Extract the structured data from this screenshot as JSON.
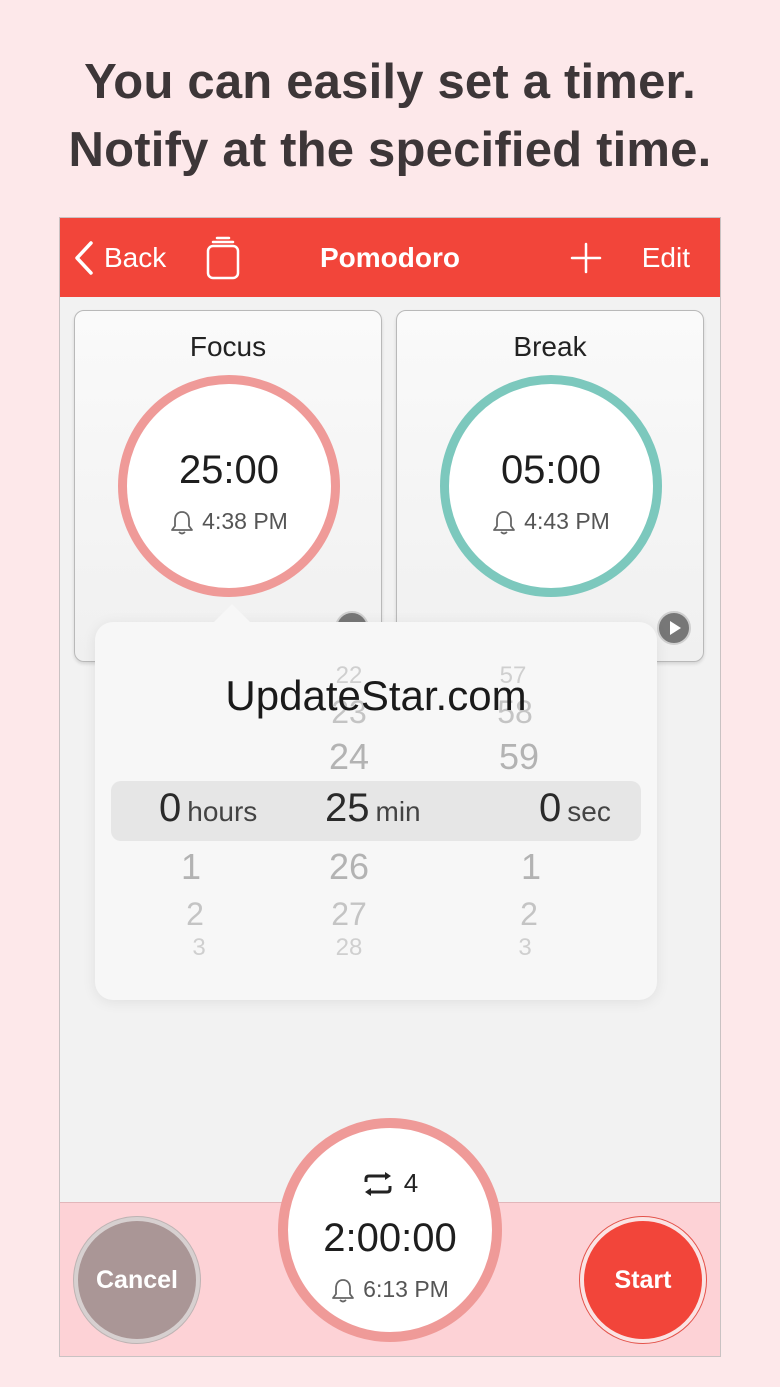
{
  "headline": {
    "line1": "You can easily set a timer.",
    "line2": "Notify at the specified time."
  },
  "navbar": {
    "back_label": "Back",
    "title": "Pomodoro",
    "edit_label": "Edit",
    "color": "#f2453a"
  },
  "cards": [
    {
      "title": "Focus",
      "time": "25:00",
      "alarm": "4:38 PM",
      "ring_color": "#ef9a98"
    },
    {
      "title": "Break",
      "time": "05:00",
      "alarm": "4:43 PM",
      "ring_color": "#7cc8bd"
    }
  ],
  "picker": {
    "hours": {
      "above": [],
      "selected": "0",
      "unit": "hours",
      "below": [
        "1",
        "2",
        "3"
      ]
    },
    "minutes": {
      "above": [
        "22",
        "23",
        "24"
      ],
      "selected": "25",
      "unit": "min",
      "below": [
        "26",
        "27",
        "28"
      ]
    },
    "seconds": {
      "above": [
        "57",
        "58",
        "59"
      ],
      "selected": "0",
      "unit": "sec",
      "below": [
        "1",
        "2",
        "3"
      ]
    }
  },
  "watermark": "UpdateStar.com",
  "bottom": {
    "cancel_label": "Cancel",
    "start_label": "Start",
    "repeat_count": "4",
    "total_time": "2:00:00",
    "total_alarm": "6:13 PM"
  }
}
